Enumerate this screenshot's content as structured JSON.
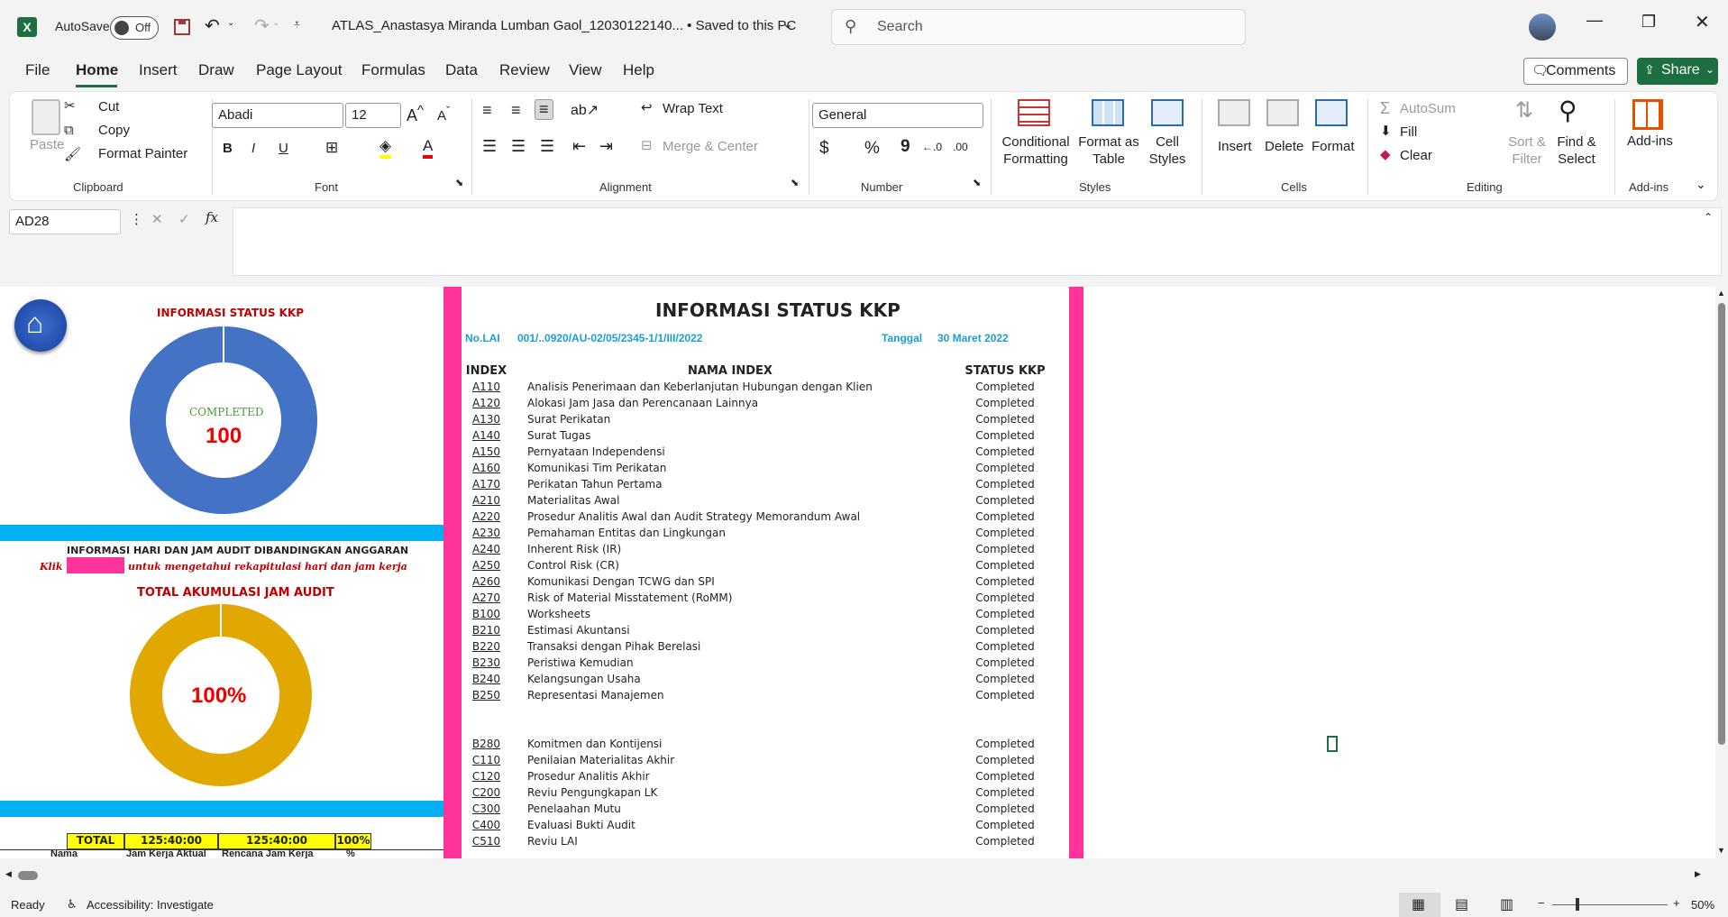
{
  "window": {
    "autosave_label": "AutoSave",
    "autosave_state": "Off",
    "title": "ATLAS_Anastasya Miranda Lumban Gaol_12030122140... • Saved to this PC",
    "search_placeholder": "Search"
  },
  "menu": [
    "File",
    "Home",
    "Insert",
    "Draw",
    "Page Layout",
    "Formulas",
    "Data",
    "Review",
    "View",
    "Help"
  ],
  "actions": {
    "comments": "Comments",
    "share": "Share"
  },
  "ribbon": {
    "clipboard": {
      "paste": "Paste",
      "cut": "Cut",
      "copy": "Copy",
      "format_painter": "Format Painter",
      "label": "Clipboard"
    },
    "font": {
      "name": "Abadi",
      "size": "12",
      "label": "Font",
      "bold": "B",
      "italic": "I",
      "underline": "U"
    },
    "alignment": {
      "wrap": "Wrap Text",
      "merge": "Merge & Center",
      "label": "Alignment"
    },
    "number": {
      "format": "General",
      "label": "Number",
      "currency": "$",
      "percent": "%",
      "comma": "9"
    },
    "styles": {
      "conditional": "Conditional Formatting",
      "format_table": "Format as Table",
      "cell_styles": "Cell Styles",
      "label": "Styles"
    },
    "cells": {
      "insert": "Insert",
      "delete": "Delete",
      "format": "Format",
      "label": "Cells"
    },
    "editing": {
      "autosum": "AutoSum",
      "fill": "Fill",
      "clear": "Clear",
      "sort": "Sort & Filter",
      "find": "Find & Select",
      "label": "Editing"
    },
    "addins": {
      "addins": "Add-ins",
      "label": "Add-ins"
    }
  },
  "formula_bar": {
    "name_box": "AD28",
    "fx": "fx",
    "content": ""
  },
  "dashboard": {
    "status_title": "INFORMASI STATUS KKP",
    "donut_label": "COMPLETED",
    "donut_value": "100",
    "hours_title": "INFORMASI HARI DAN JAM AUDIT DIBANDINGKAN ANGGARAN",
    "click_prefix": "Klik",
    "click_suffix": "untuk mengetahui rekapitulasi hari dan jam kerja",
    "total_title": "TOTAL AKUMULASI JAM AUDIT",
    "total_value": "100%",
    "total_row": {
      "label": "TOTAL",
      "actual": "125:40:00",
      "budget": "125:40:00",
      "pct": "100%"
    },
    "col_headers": [
      "Nama",
      "Jam Kerja Aktual",
      "Rencana Jam Kerja",
      "%"
    ],
    "status_pct": 1.0,
    "hours_pct": 1.0,
    "colors": {
      "blue": "#4472c4",
      "gold": "#e0a800",
      "pink": "#ff3399",
      "cyan": "#00b0f0",
      "yellow": "#ffff00"
    }
  },
  "kkp": {
    "title": "INFORMASI STATUS KKP",
    "no_lai_label": "No.LAI",
    "no_lai_value": "001/..0920/AU-02/05/2345-1/1/III/2022",
    "tanggal_label": "Tanggal",
    "tanggal_value": "30 Maret 2022",
    "headers": {
      "index": "INDEX",
      "name": "NAMA INDEX",
      "status": "STATUS KKP"
    },
    "rows": [
      {
        "code": "A110",
        "name": "Analisis Penerimaan dan Keberlanjutan Hubungan dengan Klien",
        "status": "Completed"
      },
      {
        "code": "A120",
        "name": "Alokasi Jam Jasa dan Perencanaan Lainnya",
        "status": "Completed"
      },
      {
        "code": "A130",
        "name": "Surat Perikatan",
        "status": "Completed"
      },
      {
        "code": "A140",
        "name": "Surat Tugas",
        "status": "Completed"
      },
      {
        "code": "A150",
        "name": "Pernyataan Independensi",
        "status": "Completed"
      },
      {
        "code": "A160",
        "name": "Komunikasi Tim Perikatan",
        "status": "Completed"
      },
      {
        "code": "A170",
        "name": "Perikatan Tahun Pertama",
        "status": "Completed"
      },
      {
        "code": "A210",
        "name": "Materialitas Awal",
        "status": "Completed"
      },
      {
        "code": "A220",
        "name": "Prosedur Analitis Awal dan Audit Strategy Memorandum Awal",
        "status": "Completed"
      },
      {
        "code": "A230",
        "name": "Pemahaman Entitas dan Lingkungan",
        "status": "Completed"
      },
      {
        "code": "A240",
        "name": "Inherent Risk (IR)",
        "status": "Completed"
      },
      {
        "code": "A250",
        "name": "Control Risk (CR)",
        "status": "Completed"
      },
      {
        "code": "A260",
        "name": "Komunikasi Dengan TCWG dan SPI",
        "status": "Completed"
      },
      {
        "code": "A270",
        "name": "Risk of Material Misstatement (RoMM)",
        "status": "Completed"
      },
      {
        "code": "B100",
        "name": "Worksheets",
        "status": "Completed"
      },
      {
        "code": "B210",
        "name": "Estimasi Akuntansi",
        "status": "Completed"
      },
      {
        "code": "B220",
        "name": "Transaksi dengan Pihak Berelasi",
        "status": "Completed"
      },
      {
        "code": "B230",
        "name": "Peristiwa Kemudian",
        "status": "Completed"
      },
      {
        "code": "B240",
        "name": "Kelangsungan Usaha",
        "status": "Completed"
      },
      {
        "code": "B250",
        "name": "Representasi Manajemen",
        "status": "Completed"
      },
      {
        "code": "",
        "name": "",
        "status": ""
      },
      {
        "code": "",
        "name": "",
        "status": ""
      },
      {
        "code": "B280",
        "name": "Komitmen dan Kontijensi",
        "status": "Completed"
      },
      {
        "code": "C110",
        "name": "Penilaian Materialitas Akhir",
        "status": "Completed"
      },
      {
        "code": "C120",
        "name": "Prosedur Analitis Akhir",
        "status": "Completed"
      },
      {
        "code": "C200",
        "name": "Reviu Pengungkapan LK",
        "status": "Completed"
      },
      {
        "code": "C300",
        "name": "Penelaahan Mutu",
        "status": "Completed"
      },
      {
        "code": "C400",
        "name": "Evaluasi Bukti Audit",
        "status": "Completed"
      },
      {
        "code": "C510",
        "name": "Reviu LAI",
        "status": "Completed"
      }
    ]
  },
  "status": {
    "ready": "Ready",
    "accessibility": "Accessibility: Investigate",
    "zoom": "50%"
  }
}
